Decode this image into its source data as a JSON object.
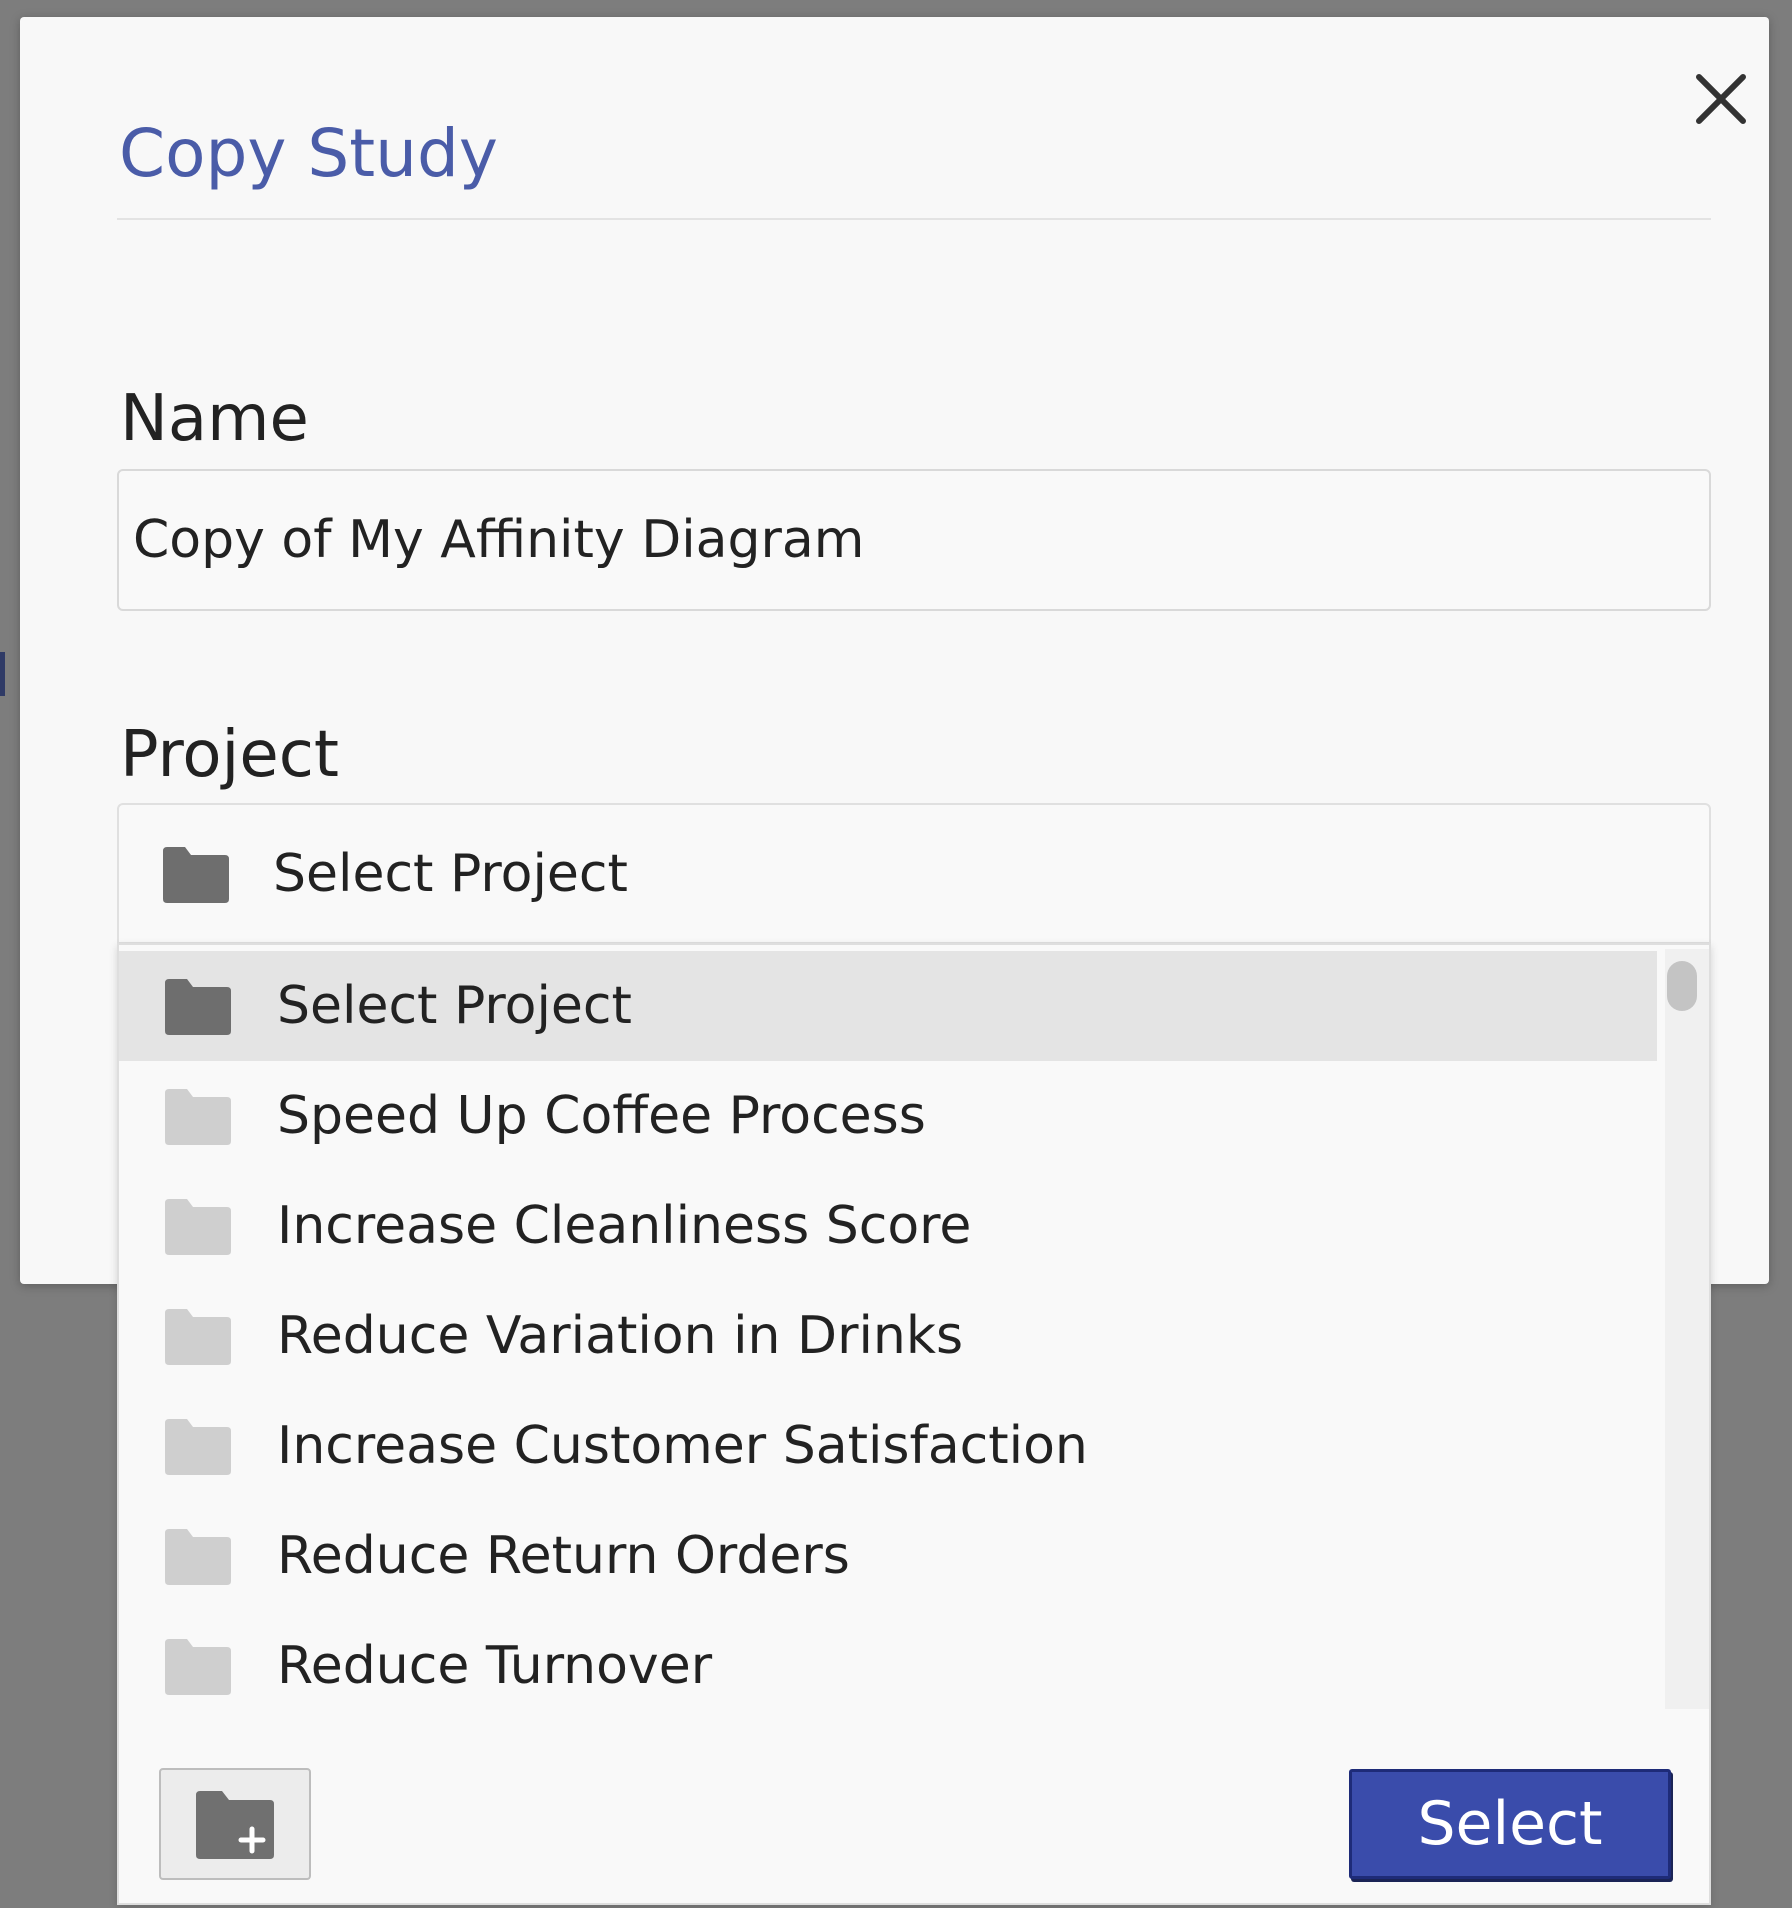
{
  "dialog": {
    "title": "Copy Study",
    "close_icon": "close-icon"
  },
  "name_field": {
    "label": "Name",
    "value": "Copy of My Affinity Diagram"
  },
  "project_field": {
    "label": "Project",
    "selected": "Select Project"
  },
  "project_options": [
    "Select Project",
    "Speed Up Coffee Process",
    "Increase Cleanliness Score",
    "Reduce Variation in Drinks",
    "Increase Customer Satisfaction",
    "Reduce Return Orders",
    "Reduce Turnover"
  ],
  "footer": {
    "new_folder_icon": "folder-plus-icon",
    "select_label": "Select"
  },
  "colors": {
    "title": "#4a5ca8",
    "primary_button": "#3a4cab",
    "overlay": "#7d7d7d",
    "folder_dark": "#6e6e6e",
    "folder_light": "#cfcfcf"
  }
}
